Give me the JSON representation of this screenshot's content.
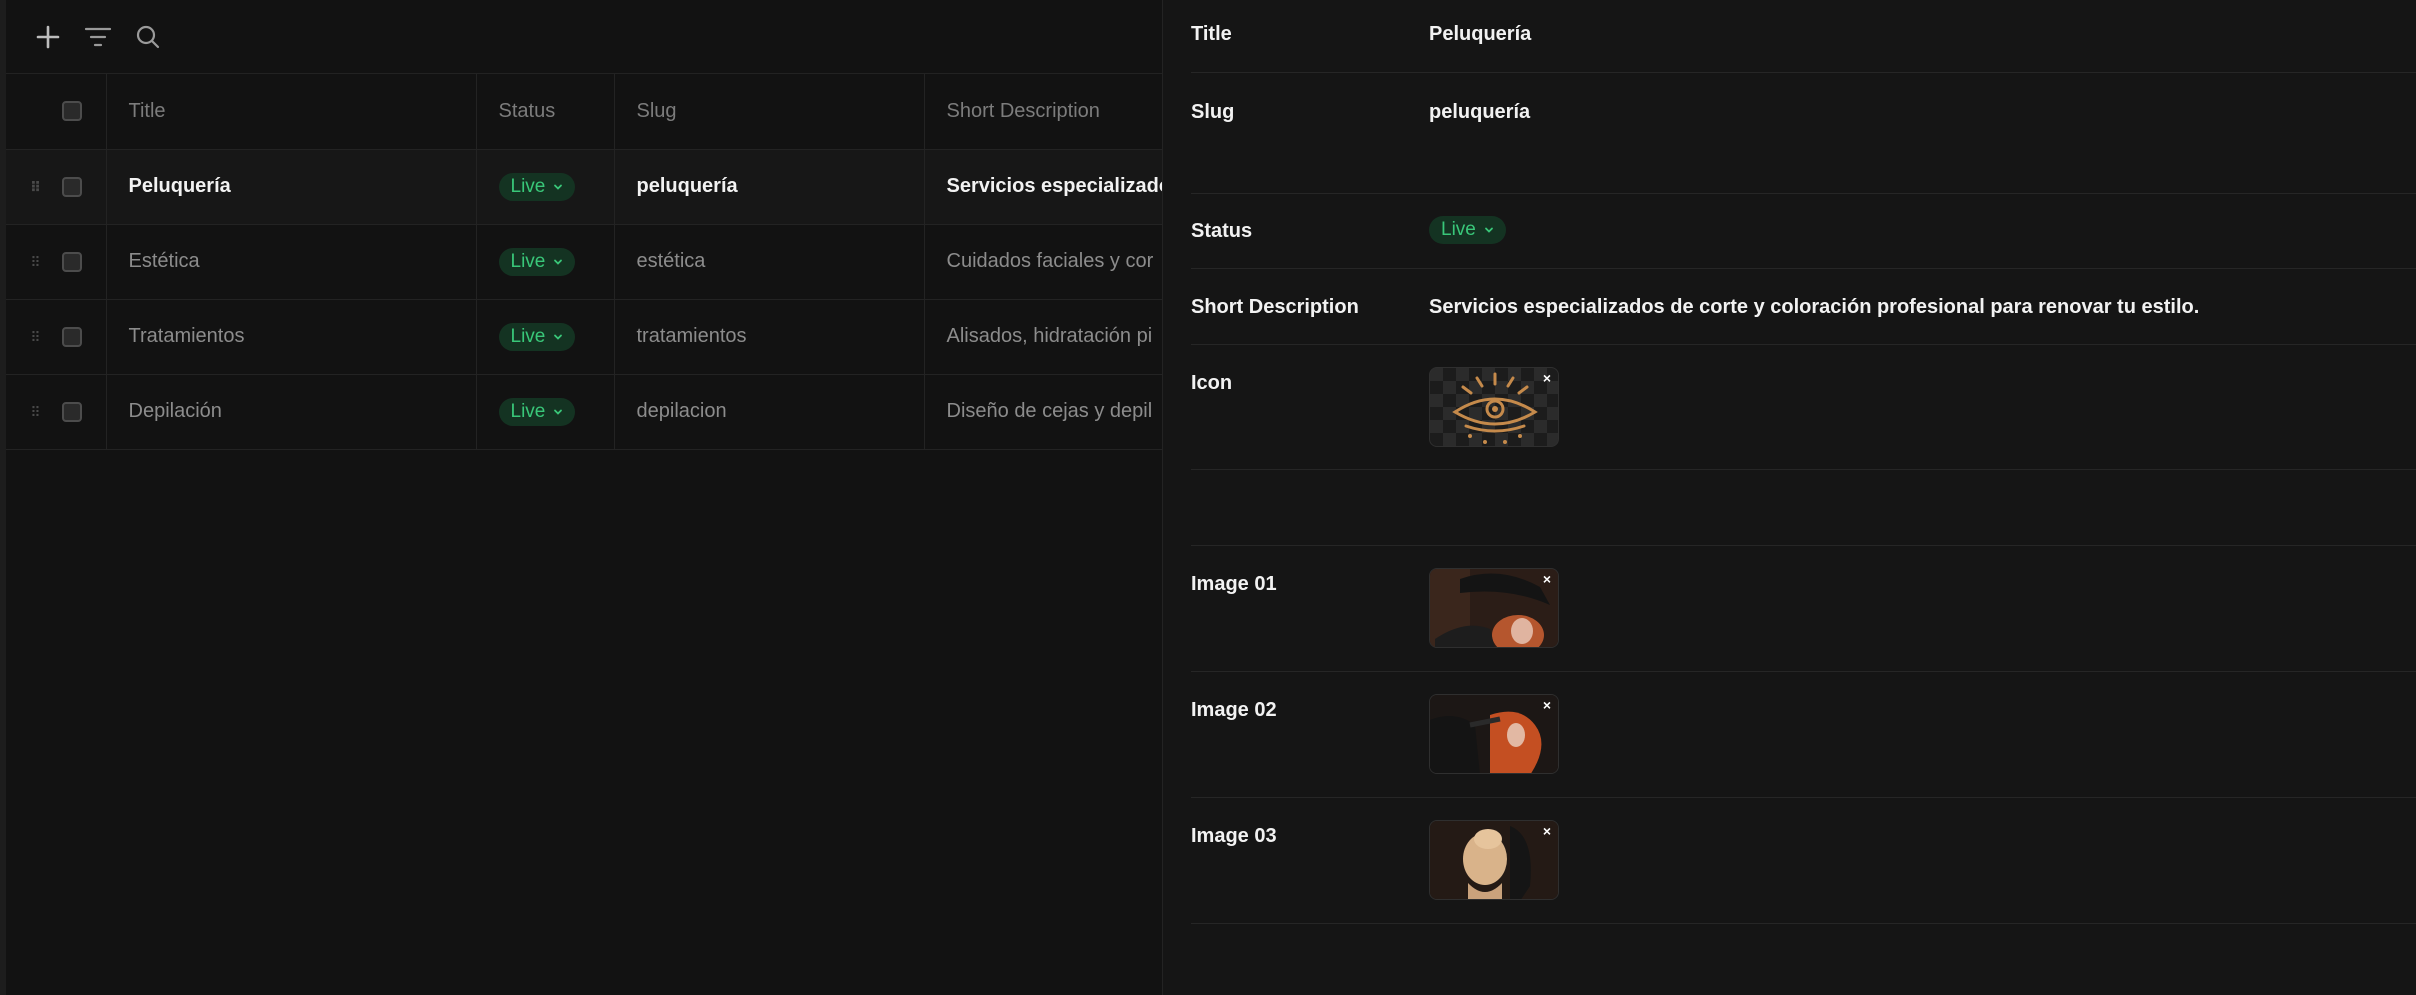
{
  "columns": {
    "title": "Title",
    "status": "Status",
    "slug": "Slug",
    "short_description": "Short Description"
  },
  "rows": [
    {
      "title": "Peluquería",
      "status": "Live",
      "slug": "peluquería",
      "short_description": "Servicios especializado"
    },
    {
      "title": "Estética",
      "status": "Live",
      "slug": "estética",
      "short_description": "Cuidados faciales y cor"
    },
    {
      "title": "Tratamientos",
      "status": "Live",
      "slug": "tratamientos",
      "short_description": "Alisados, hidratación pi"
    },
    {
      "title": "Depilación",
      "status": "Live",
      "slug": "depilacion",
      "short_description": "Diseño de cejas y depil"
    }
  ],
  "detail": {
    "title_label": "Title",
    "title_value": "Peluquería",
    "slug_label": "Slug",
    "slug_value": "peluquería",
    "status_label": "Status",
    "status_value": "Live",
    "short_description_label": "Short Description",
    "short_description_value": "Servicios especializados de corte y coloración profesional para renovar tu estilo.",
    "icon_label": "Icon",
    "image_01_label": "Image 01",
    "image_02_label": "Image 02",
    "image_03_label": "Image 03",
    "remove_glyph": "×"
  },
  "icons": {
    "add": "plus-icon",
    "filter": "filter-icon",
    "search": "search-icon",
    "drag": "drag-handle-icon",
    "status_chevron": "chevron-down-icon",
    "remove": "close-icon"
  },
  "colors": {
    "background": "#111111",
    "panel": "#151515",
    "live_badge_bg": "#143322",
    "live_badge_text": "#39c779",
    "icon_accent": "#c58a4b"
  }
}
